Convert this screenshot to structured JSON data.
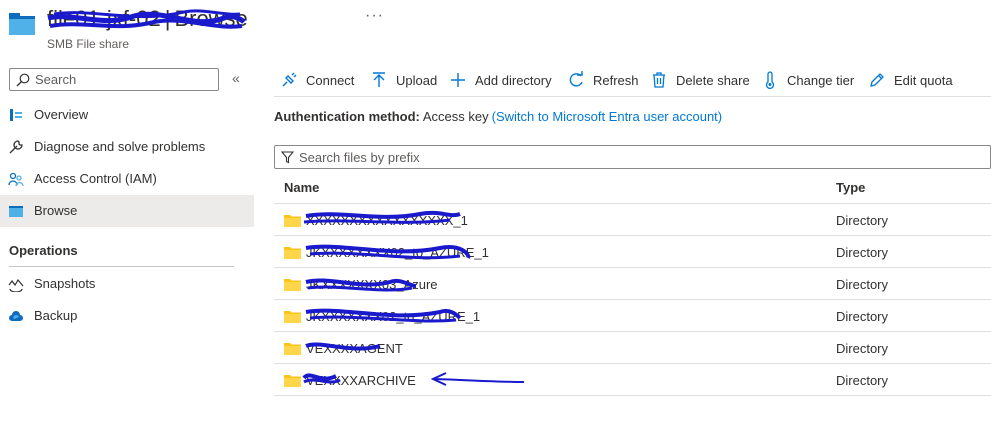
{
  "header": {
    "resource_name": "file01-jxf-02",
    "separator": "|",
    "page": "Browse",
    "more": "···",
    "subtitle": "SMB File share"
  },
  "sidebar": {
    "search_placeholder": "Search",
    "collapse": "«",
    "items": [
      {
        "label": "Overview",
        "icon": "overview-icon"
      },
      {
        "label": "Diagnose and solve problems",
        "icon": "wrench-icon"
      },
      {
        "label": "Access Control (IAM)",
        "icon": "people-icon"
      },
      {
        "label": "Browse",
        "icon": "folder-icon",
        "active": true
      }
    ],
    "section": "Operations",
    "ops": [
      {
        "label": "Snapshots",
        "icon": "snapshot-icon"
      },
      {
        "label": "Backup",
        "icon": "cloud-backup-icon"
      }
    ]
  },
  "toolbar": {
    "connect": "Connect",
    "upload": "Upload",
    "add_directory": "Add directory",
    "refresh": "Refresh",
    "delete_share": "Delete share",
    "change_tier": "Change tier",
    "edit_quota": "Edit quota"
  },
  "auth": {
    "label": "Authentication method:",
    "value": "Access key",
    "link": "(Switch to Microsoft Entra user account)"
  },
  "filter": {
    "placeholder": "Search files by prefix"
  },
  "grid": {
    "col_name": "Name",
    "col_type": "Directory",
    "col_type_header": "Type",
    "rows": [
      {
        "name": "XXXXXXXXXXXXXXXXX_1",
        "type": "Directory"
      },
      {
        "name": "JKXXXXXXXX02_to_AZURE_1",
        "type": "Directory"
      },
      {
        "name": "JKXXXXXXX03_Azure",
        "type": "Directory"
      },
      {
        "name": "JKXXXXXXX02_to_AZURE_1",
        "type": "Directory"
      },
      {
        "name": "VEXXXXAGENT",
        "type": "Directory"
      },
      {
        "name": "VEXXXXARCHIVE",
        "type": "Directory"
      }
    ]
  },
  "colors": {
    "accent": "#0078d4",
    "folder": "#fcc419",
    "scribble": "#1a1acc"
  }
}
